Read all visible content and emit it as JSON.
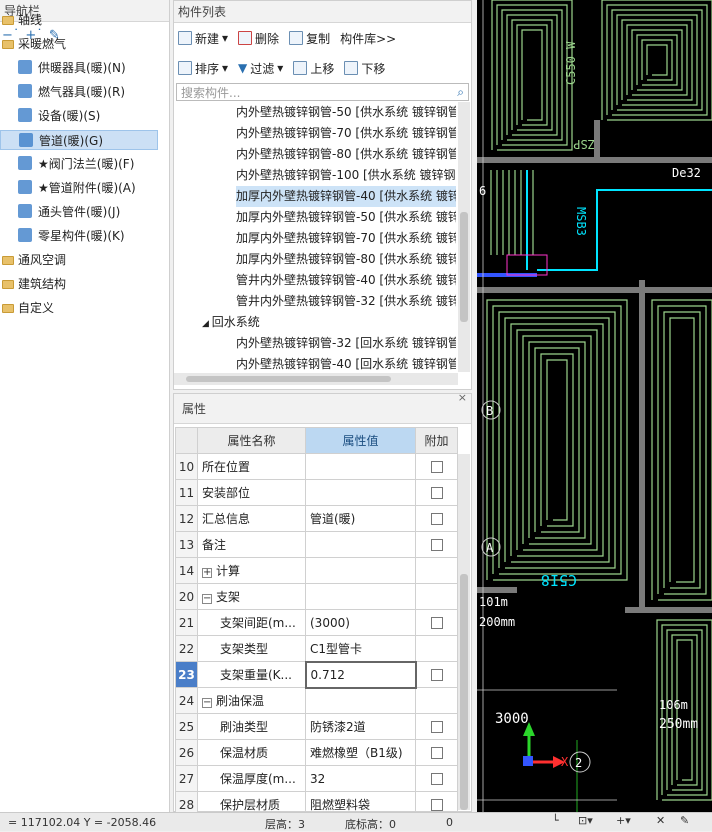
{
  "nav": {
    "title": "导航栏",
    "tool_icons": [
      "collapse-icon",
      "expand-icon",
      "edit-icon"
    ],
    "items": [
      {
        "label": "轴线",
        "type": "folder",
        "level": 0
      },
      {
        "label": "采暖燃气",
        "type": "folder",
        "level": 0
      },
      {
        "label": "供暖器具(暖)(N)",
        "type": "item",
        "icon": "radiator-icon",
        "level": 1
      },
      {
        "label": "燃气器具(暖)(R)",
        "type": "item",
        "icon": "gas-appliance-icon",
        "level": 1
      },
      {
        "label": "设备(暖)(S)",
        "type": "item",
        "icon": "equipment-icon",
        "level": 1
      },
      {
        "label": "管道(暖)(G)",
        "type": "item",
        "icon": "pipe-icon",
        "level": 1,
        "selected": true
      },
      {
        "label": "★阀门法兰(暖)(F)",
        "type": "item",
        "icon": "valve-icon",
        "level": 1
      },
      {
        "label": "★管道附件(暖)(A)",
        "type": "item",
        "icon": "pipe-fitting-icon",
        "level": 1
      },
      {
        "label": "通头管件(暖)(J)",
        "type": "item",
        "icon": "tee-icon",
        "level": 1
      },
      {
        "label": "零星构件(暖)(K)",
        "type": "item",
        "icon": "misc-component-icon",
        "level": 1
      },
      {
        "label": "通风空调",
        "type": "folder",
        "level": 0
      },
      {
        "label": "建筑结构",
        "type": "folder",
        "level": 0
      },
      {
        "label": "自定义",
        "type": "folder",
        "level": 0
      }
    ]
  },
  "components": {
    "title": "构件列表",
    "toolbar1": {
      "new": "新建",
      "delete": "删除",
      "copy": "复制",
      "library": "构件库>>"
    },
    "toolbar2": {
      "sort": "排序",
      "filter": "过滤",
      "up": "上移",
      "down": "下移"
    },
    "search_placeholder": "搜索构件...",
    "rows": [
      {
        "label": "内外壁热镀锌钢管-50 [供水系统 镀锌钢管",
        "indent": 1
      },
      {
        "label": "内外壁热镀锌钢管-70 [供水系统 镀锌钢管",
        "indent": 1
      },
      {
        "label": "内外壁热镀锌钢管-80 [供水系统 镀锌钢管",
        "indent": 1
      },
      {
        "label": "内外壁热镀锌钢管-100 [供水系统 镀锌钢",
        "indent": 1
      },
      {
        "label": "加厚内外壁热镀锌钢管-40 [供水系统 镀锌",
        "indent": 1,
        "selected": true
      },
      {
        "label": "加厚内外壁热镀锌钢管-50 [供水系统 镀锌",
        "indent": 1
      },
      {
        "label": "加厚内外壁热镀锌钢管-70 [供水系统 镀锌",
        "indent": 1
      },
      {
        "label": "加厚内外壁热镀锌钢管-80 [供水系统 镀锌",
        "indent": 1
      },
      {
        "label": "管井内外壁热镀锌钢管-40 [供水系统 镀锌",
        "indent": 1
      },
      {
        "label": "管井内外壁热镀锌钢管-32 [供水系统 镀锌",
        "indent": 1
      },
      {
        "label": "回水系统",
        "indent": 0,
        "group": true
      },
      {
        "label": "内外壁热镀锌钢管-32 [回水系统 镀锌钢管",
        "indent": 1
      },
      {
        "label": "内外壁热镀锌钢管-40 [回水系统 镀锌钢管",
        "indent": 1
      }
    ]
  },
  "properties": {
    "title": "属性",
    "headers": {
      "name": "属性名称",
      "value": "属性值",
      "extra": "附加"
    },
    "rows": [
      {
        "num": "10",
        "name": "所在位置",
        "value": "",
        "checkbox": true
      },
      {
        "num": "11",
        "name": "安装部位",
        "value": "",
        "checkbox": true
      },
      {
        "num": "12",
        "name": "汇总信息",
        "value": "管道(暖)",
        "checkbox": true
      },
      {
        "num": "13",
        "name": "备注",
        "value": "",
        "checkbox": true
      },
      {
        "num": "14",
        "name": "计算",
        "value": "",
        "group": "+"
      },
      {
        "num": "20",
        "name": "支架",
        "value": "",
        "group": "−"
      },
      {
        "num": "21",
        "name": "支架间距(m...",
        "value": "(3000)",
        "checkbox": true,
        "child": true
      },
      {
        "num": "22",
        "name": "支架类型",
        "value": "C1型管卡",
        "child": true
      },
      {
        "num": "23",
        "name": "支架重量(K...",
        "value": "0.712",
        "checkbox": true,
        "child": true,
        "current": true
      },
      {
        "num": "24",
        "name": "刷油保温",
        "value": "",
        "group": "−"
      },
      {
        "num": "25",
        "name": "刷油类型",
        "value": "防锈漆2道",
        "checkbox": true,
        "child": true
      },
      {
        "num": "26",
        "name": "保温材质",
        "value": "难燃橡塑（B1级)",
        "checkbox": true,
        "child": true
      },
      {
        "num": "27",
        "name": "保温厚度(m...",
        "value": "32",
        "checkbox": true,
        "child": true
      },
      {
        "num": "28",
        "name": "保护层材质",
        "value": "阻燃塑料袋",
        "checkbox": true,
        "child": true
      }
    ]
  },
  "cad": {
    "labels": [
      "C550 W",
      "De32",
      "ZSP",
      "MSB3",
      "C5I8",
      "101m",
      "200mm",
      "106m",
      "250mm",
      "3000",
      "X",
      "B",
      "A",
      "2",
      "6"
    ],
    "colors": {
      "background": "#000000",
      "pipe": "#9bd48c",
      "wall": "#7a7a7a",
      "cyan": "#00e5ff",
      "blue": "#3355ff"
    }
  },
  "status": {
    "coords": "= 117102.04 Y = -2058.46",
    "floor_height": "层高：3",
    "bottom_elevation": "底标高：0",
    "zero": "0"
  }
}
